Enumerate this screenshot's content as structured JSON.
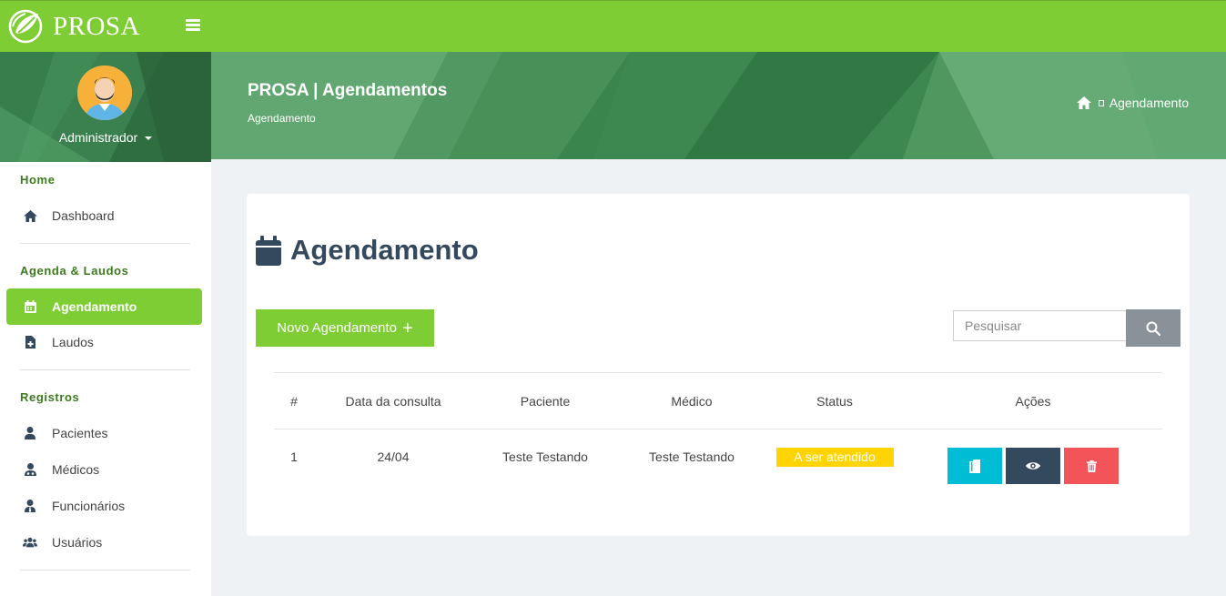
{
  "app": {
    "name": "PROSA"
  },
  "user": {
    "name": "Administrador"
  },
  "sidebar": {
    "sections": [
      {
        "header": "Home",
        "items": [
          {
            "label": "Dashboard",
            "icon": "home-icon"
          }
        ]
      },
      {
        "header": "Agenda & Laudos",
        "items": [
          {
            "label": "Agendamento",
            "icon": "calendar-icon",
            "active": true
          },
          {
            "label": "Laudos",
            "icon": "file-medical-icon"
          }
        ]
      },
      {
        "header": "Registros",
        "items": [
          {
            "label": "Pacientes",
            "icon": "user-icon"
          },
          {
            "label": "Médicos",
            "icon": "user-doctor-icon"
          },
          {
            "label": "Funcionários",
            "icon": "user-tie-icon"
          },
          {
            "label": "Usuários",
            "icon": "users-icon"
          }
        ]
      }
    ]
  },
  "header": {
    "title": "PROSA | Agendamentos",
    "subtitle": "Agendamento",
    "breadcrumb": [
      "Agendamento"
    ]
  },
  "main": {
    "title": "Agendamento",
    "new_button_label": "Novo Agendamento",
    "search": {
      "placeholder": "Pesquisar",
      "value": ""
    },
    "table": {
      "columns": [
        "#",
        "Data da consulta",
        "Paciente",
        "Médico",
        "Status",
        "Ações"
      ],
      "rows": [
        {
          "id": "1",
          "date": "24/04",
          "patient": "Teste Testando",
          "doctor": "Teste Testando",
          "status": "A ser atendido"
        }
      ]
    }
  },
  "colors": {
    "primary": "#7fcd35",
    "header_band": "#4f9a60",
    "status_pending": "#ffd400",
    "action_edit": "#00bcd4",
    "action_view": "#34495e",
    "action_delete": "#f3545a",
    "search_button": "#8a9299"
  }
}
